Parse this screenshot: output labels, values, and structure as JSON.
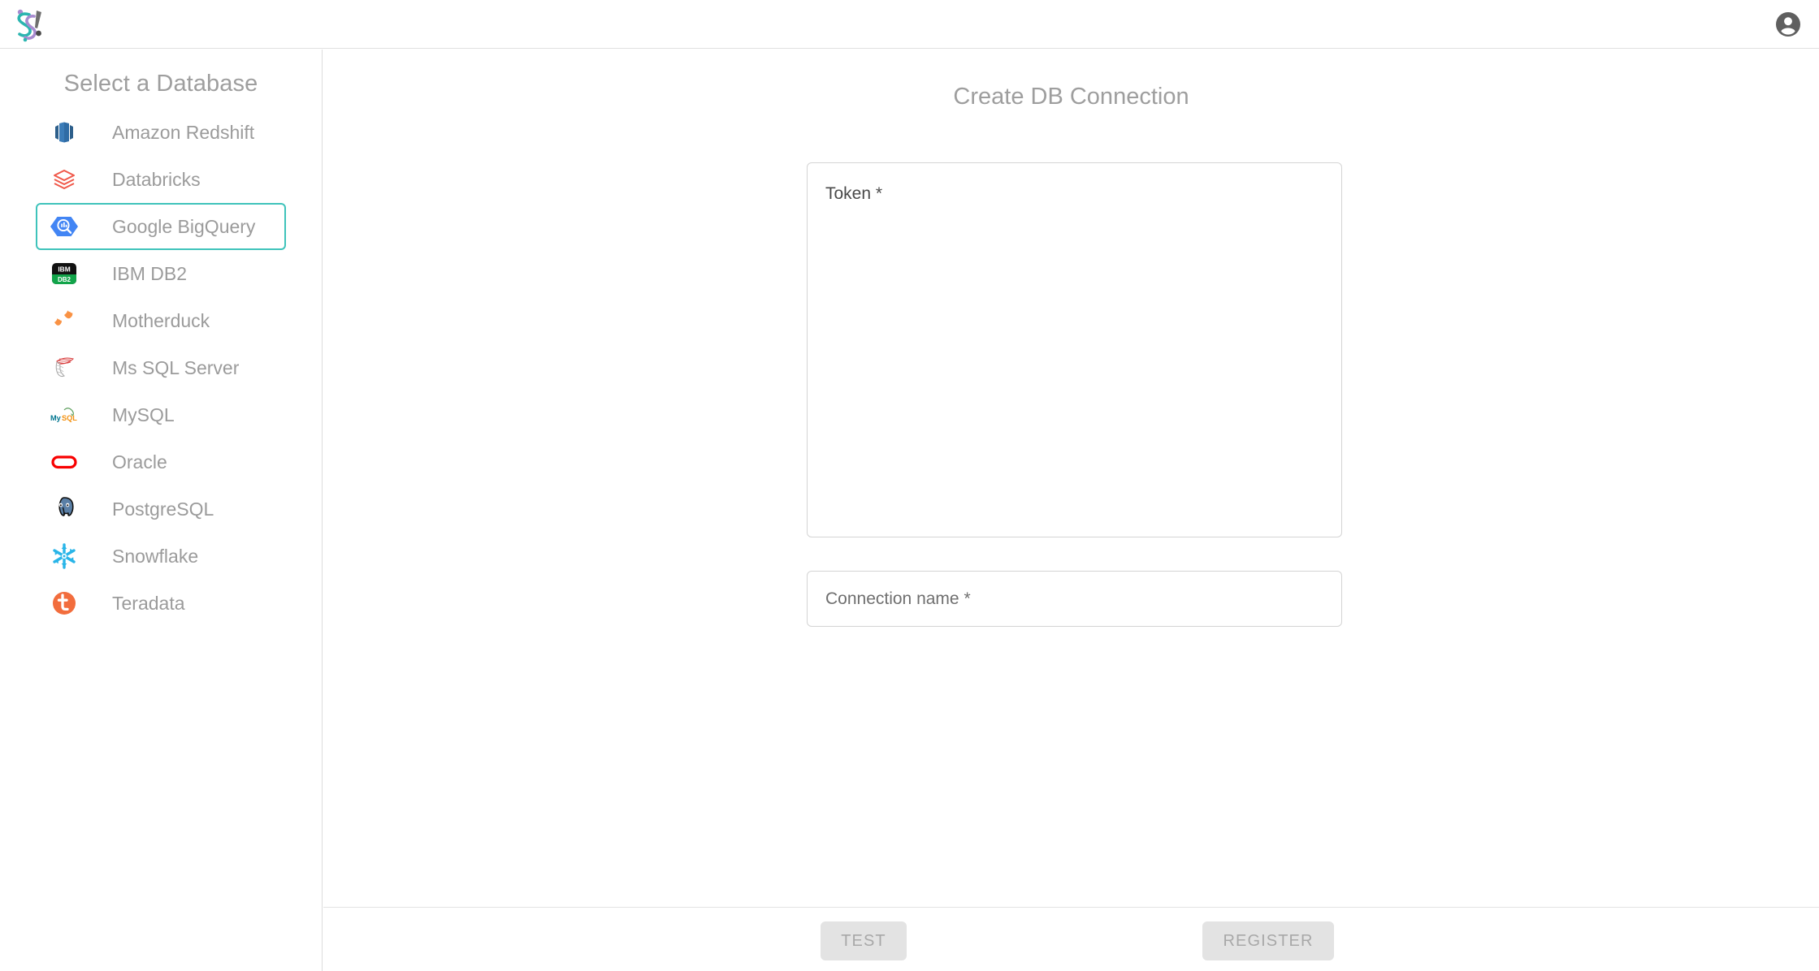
{
  "header": {
    "logo_name": "sherlock-logo",
    "account_icon": "account-circle-icon",
    "logo_colors": {
      "teal": "#2bb5b0",
      "purple": "#a78bd0",
      "gray": "#6e6e6e"
    }
  },
  "sidebar": {
    "title": "Select a Database",
    "selected_index": 2,
    "items": [
      {
        "label": "Amazon Redshift",
        "icon": "amazon-redshift-icon"
      },
      {
        "label": "Databricks",
        "icon": "databricks-icon"
      },
      {
        "label": "Google BigQuery",
        "icon": "google-bigquery-icon"
      },
      {
        "label": "IBM DB2",
        "icon": "ibm-db2-icon"
      },
      {
        "label": "Motherduck",
        "icon": "motherduck-icon"
      },
      {
        "label": "Ms SQL Server",
        "icon": "ms-sql-server-icon"
      },
      {
        "label": "MySQL",
        "icon": "mysql-icon"
      },
      {
        "label": "Oracle",
        "icon": "oracle-icon"
      },
      {
        "label": "PostgreSQL",
        "icon": "postgresql-icon"
      },
      {
        "label": "Snowflake",
        "icon": "snowflake-icon"
      },
      {
        "label": "Teradata",
        "icon": "teradata-icon"
      }
    ]
  },
  "main": {
    "title": "Create DB Connection",
    "fields": {
      "token": {
        "placeholder": "Token *",
        "value": ""
      },
      "connection_name": {
        "placeholder": "Connection name *",
        "value": ""
      }
    }
  },
  "footer": {
    "test_label": "TEST",
    "register_label": "REGISTER"
  },
  "colors": {
    "accent_selected_border": "#3fc3bb",
    "muted_text": "#9b9b9b",
    "disabled_button_bg": "#e3e3e3",
    "disabled_button_text": "#a8a8a8"
  }
}
